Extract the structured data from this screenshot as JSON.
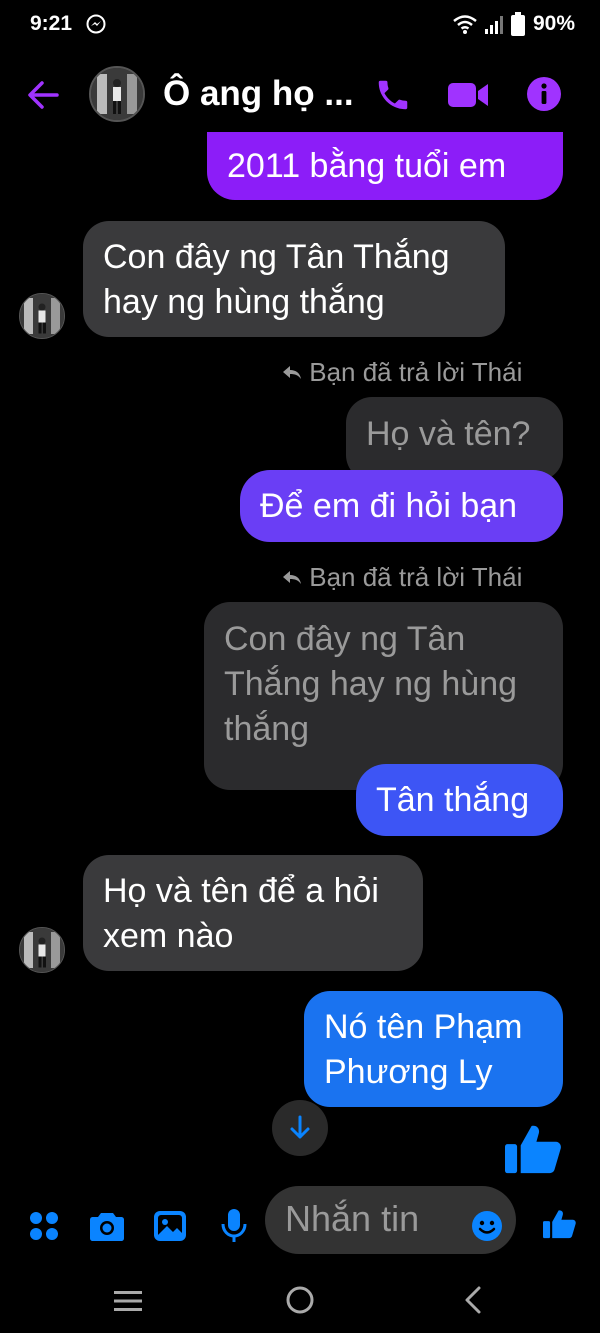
{
  "status": {
    "time": "9:21",
    "battery": "90%"
  },
  "header": {
    "title": "Ô ang họ ..."
  },
  "messages": [
    {
      "text": "2011 bằng tuổi em"
    },
    {
      "lines": [
        "Con đây ng Tân Thắng",
        "hay ng hùng thắng"
      ]
    },
    {
      "reply_label": "Bạn đã trả lời Thái",
      "quoted": "Họ và tên?",
      "text": "Để em đi hỏi bạn"
    },
    {
      "reply_label": "Bạn đã trả lời Thái",
      "quoted_lines": [
        "Con đây ng Tân",
        "Thắng hay ng hùng",
        "thắng"
      ],
      "text": "Tân thắng"
    },
    {
      "lines": [
        "Họ và tên để a hỏi",
        "xem nào"
      ]
    },
    {
      "lines": [
        "Nó tên Phạm",
        "Phương Ly"
      ]
    }
  ],
  "composer": {
    "placeholder": "Nhắn tin"
  },
  "colors": {
    "accent": "#a033ff",
    "messenger_blue": "#0a84ff",
    "bubble_purple": "#8c1df8",
    "bubble_violet": "#6a3ef5",
    "bubble_blue": "#3d55f5",
    "bubble_azure": "#1a73f0",
    "incoming": "#3a3a3c"
  },
  "icons": [
    "back-arrow-icon",
    "phone-icon",
    "video-icon",
    "info-icon",
    "reply-arrow-icon",
    "chevron-down-icon",
    "like-icon",
    "apps-icon",
    "camera-icon",
    "gallery-icon",
    "microphone-icon",
    "emoji-icon",
    "messenger-icon",
    "wifi-icon",
    "signal-icon",
    "battery-icon",
    "menu-icon",
    "home-icon",
    "nav-back-icon"
  ]
}
